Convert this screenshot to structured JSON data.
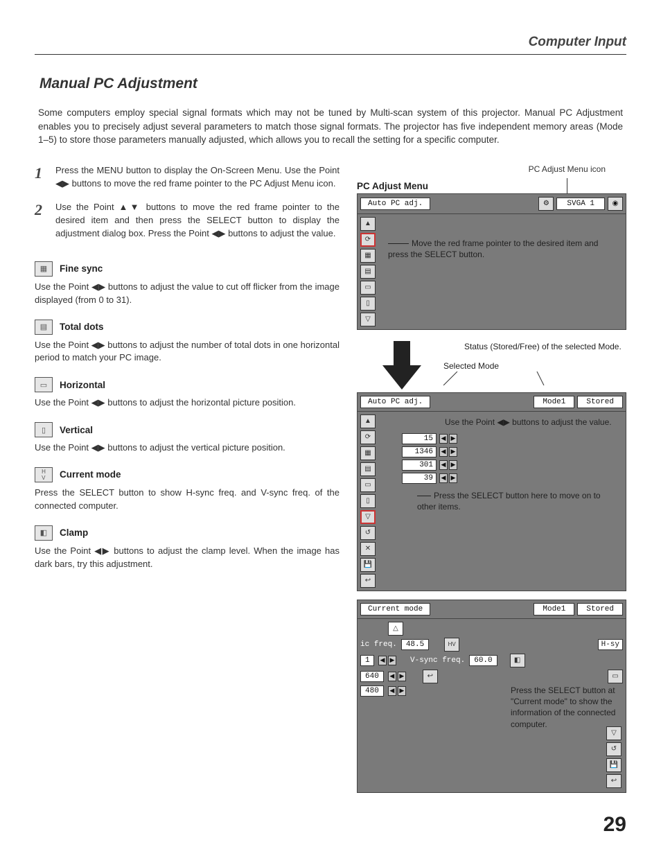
{
  "header": {
    "section": "Computer Input"
  },
  "title": "Manual PC Adjustment",
  "intro": "Some computers employ special signal formats which may not be tuned by Multi-scan system of this projector. Manual PC Adjustment enables you to precisely adjust several parameters to match those signal formats. The projector has five independent memory areas (Mode 1–5) to store those parameters manually adjusted, which allows you to recall the setting for a specific computer.",
  "steps": [
    {
      "num": "1",
      "text": "Press the MENU button to display the On-Screen Menu. Use the Point ◀▶ buttons to move the red frame pointer to the PC Adjust Menu icon."
    },
    {
      "num": "2",
      "text": "Use the Point ▲▼ buttons to move the red frame pointer to the desired item and then press the SELECT button to display the adjustment dialog box. Press the Point ◀▶ buttons to adjust the value."
    }
  ],
  "items": [
    {
      "key": "fine-sync",
      "title": "Fine sync",
      "body": "Use the Point ◀▶ buttons to adjust the value to cut off flicker from the image displayed (from 0 to 31)."
    },
    {
      "key": "total-dots",
      "title": "Total dots",
      "body": "Use the Point ◀▶ buttons to adjust the number of total dots in one horizontal period to match your PC image."
    },
    {
      "key": "horizontal",
      "title": "Horizontal",
      "body": "Use the Point ◀▶ buttons to adjust the horizontal picture position."
    },
    {
      "key": "vertical",
      "title": "Vertical",
      "body": "Use the Point ◀▶ buttons to adjust the vertical picture position."
    },
    {
      "key": "current-mode",
      "title": "Current mode",
      "body": "Press the SELECT button to show H-sync freq. and V-sync freq. of the connected computer."
    },
    {
      "key": "clamp",
      "title": "Clamp",
      "body": "Use the Point ◀▶ buttons to adjust the clamp level. When the image has dark bars, try this adjustment."
    }
  ],
  "diagram": {
    "menu_title": "PC Adjust Menu",
    "icon_note": "PC Adjust Menu icon",
    "bar1_label": "Auto PC adj.",
    "bar1_mode": "SVGA 1",
    "callout1": "Move the red frame pointer to the desired item and press the SELECT button.",
    "status_note": "Status (Stored/Free) of the selected Mode.",
    "selected_note": "Selected Mode",
    "bar2_label": "Auto PC adj.",
    "bar2_mode": "Mode1",
    "bar2_status": "Stored",
    "adjust_note": "Use the Point ◀▶ buttons to adjust the value.",
    "values": {
      "fine_sync": "15",
      "total_dots": "1346",
      "horizontal": "301",
      "vertical": "39"
    },
    "scroll_note": "Press the SELECT button here to move on to other items.",
    "bar3_label": "Current mode",
    "bar3_mode": "Mode1",
    "bar3_status": "Stored",
    "p3": {
      "h_label_left": "ic freq.",
      "h_val": "48.5",
      "h_label_right": "H-sy",
      "v_label": "V-sync freq.",
      "v_val": "60.0",
      "row3_val": "1",
      "row4_val": "640",
      "row5_val": "480",
      "caption": "Press the SELECT button at \"Current mode\" to show the information of the connected computer."
    }
  },
  "page_number": "29"
}
